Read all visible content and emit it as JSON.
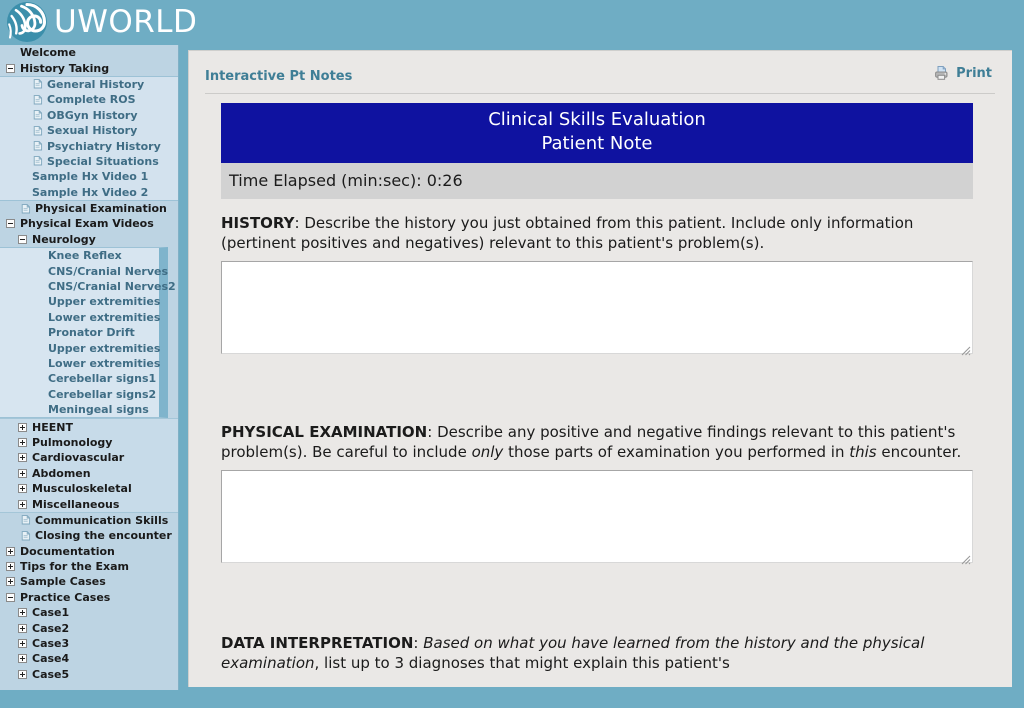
{
  "brand": {
    "name": "UWORLD",
    "logo_icon": "swirl-logo-icon",
    "header_color": "#6fadc4"
  },
  "sidebar": {
    "items": [
      {
        "label": "Welcome",
        "level": 0,
        "kind": "plain",
        "icon": null
      },
      {
        "label": "History Taking",
        "level": 0,
        "kind": "toggle-minus",
        "icon": null
      },
      {
        "label": "General History",
        "level": 1,
        "kind": "link",
        "icon": "document-icon"
      },
      {
        "label": "Complete ROS",
        "level": 1,
        "kind": "link",
        "icon": "document-icon"
      },
      {
        "label": "OBGyn History",
        "level": 1,
        "kind": "link",
        "icon": "document-icon"
      },
      {
        "label": "Sexual History",
        "level": 1,
        "kind": "link",
        "icon": "document-icon"
      },
      {
        "label": "Psychiatry History",
        "level": 1,
        "kind": "link",
        "icon": "document-icon"
      },
      {
        "label": "Special Situations",
        "level": 1,
        "kind": "link",
        "icon": "document-icon"
      },
      {
        "label": "Sample Hx Video 1",
        "level": 1,
        "kind": "link",
        "icon": null
      },
      {
        "label": "Sample Hx Video 2",
        "level": 1,
        "kind": "link",
        "icon": null
      },
      {
        "label": "Physical Examination",
        "level": 0,
        "kind": "plain",
        "icon": "document-icon"
      },
      {
        "label": "Physical Exam Videos",
        "level": 0,
        "kind": "toggle-minus",
        "icon": null
      },
      {
        "label": "Neurology",
        "level": 1,
        "kind": "toggle-minus",
        "icon": null
      },
      {
        "label": "Knee Reflex",
        "level": 2,
        "kind": "link",
        "icon": null
      },
      {
        "label": "CNS/Cranial Nerves",
        "level": 2,
        "kind": "link",
        "icon": null
      },
      {
        "label": "CNS/Cranial Nerves2",
        "level": 2,
        "kind": "link",
        "icon": null
      },
      {
        "label": "Upper extremities",
        "level": 2,
        "kind": "link",
        "icon": null
      },
      {
        "label": "Lower extremities",
        "level": 2,
        "kind": "link",
        "icon": null
      },
      {
        "label": "Pronator Drift",
        "level": 2,
        "kind": "link",
        "icon": null
      },
      {
        "label": "Upper extremities",
        "level": 2,
        "kind": "link",
        "icon": null
      },
      {
        "label": "Lower extremities",
        "level": 2,
        "kind": "link",
        "icon": null
      },
      {
        "label": "Cerebellar signs1",
        "level": 2,
        "kind": "link",
        "icon": null
      },
      {
        "label": "Cerebellar signs2",
        "level": 2,
        "kind": "link",
        "icon": null
      },
      {
        "label": "Meningeal signs",
        "level": 2,
        "kind": "link",
        "icon": null
      },
      {
        "label": "HEENT",
        "level": 1,
        "kind": "toggle-plus",
        "icon": null
      },
      {
        "label": "Pulmonology",
        "level": 1,
        "kind": "toggle-plus",
        "icon": null
      },
      {
        "label": "Cardiovascular",
        "level": 1,
        "kind": "toggle-plus",
        "icon": null
      },
      {
        "label": "Abdomen",
        "level": 1,
        "kind": "toggle-plus",
        "icon": null
      },
      {
        "label": "Musculoskeletal",
        "level": 1,
        "kind": "toggle-plus",
        "icon": null
      },
      {
        "label": "Miscellaneous",
        "level": 1,
        "kind": "toggle-plus",
        "icon": null
      },
      {
        "label": "Communication Skills",
        "level": 0,
        "kind": "plain",
        "icon": "document-icon"
      },
      {
        "label": "Closing the encounter",
        "level": 0,
        "kind": "plain",
        "icon": "document-icon"
      },
      {
        "label": "Documentation",
        "level": 0,
        "kind": "toggle-plus",
        "icon": null
      },
      {
        "label": "Tips for the Exam",
        "level": 0,
        "kind": "toggle-plus",
        "icon": null
      },
      {
        "label": "Sample Cases",
        "level": 0,
        "kind": "toggle-plus",
        "icon": null
      },
      {
        "label": "Practice Cases",
        "level": 0,
        "kind": "toggle-minus",
        "icon": null
      },
      {
        "label": "Case1",
        "level": 1,
        "kind": "toggle-plus",
        "icon": null
      },
      {
        "label": "Case2",
        "level": 1,
        "kind": "toggle-plus",
        "icon": null
      },
      {
        "label": "Case3",
        "level": 1,
        "kind": "toggle-plus",
        "icon": null
      },
      {
        "label": "Case4",
        "level": 1,
        "kind": "toggle-plus",
        "icon": null
      },
      {
        "label": "Case5",
        "level": 1,
        "kind": "toggle-plus",
        "icon": null
      }
    ]
  },
  "header": {
    "page_title": "Interactive Pt Notes",
    "print_label": "Print",
    "print_icon": "printer-icon",
    "accent_color": "#3f7e96"
  },
  "note": {
    "banner_line1": "Clinical Skills Evaluation",
    "banner_line2": "Patient Note",
    "banner_color": "#0f12a0",
    "timer_label": "Time Elapsed (min:sec):",
    "timer_value": "0:26",
    "history": {
      "heading": "HISTORY",
      "text_1": ": Describe the history you just obtained from this patient. Include only information (pertinent positives and negatives) relevant to this patient's problem(s).",
      "value": "",
      "placeholder": ""
    },
    "physical_exam": {
      "heading": "PHYSICAL EXAMINATION",
      "text_1": ": Describe any positive and negative findings relevant to this patient's problem(s). Be careful to include ",
      "em_1": "only",
      "text_2": " those parts of examination you performed in ",
      "em_2": "this",
      "text_3": " encounter.",
      "value": "",
      "placeholder": ""
    },
    "data_interpretation": {
      "heading": "DATA INTERPRETATION",
      "text_1": ": ",
      "em_1": "Based on what you have learned from the history and the physical examination",
      "text_2": ", list up to 3 diagnoses that might explain this patient's"
    }
  }
}
